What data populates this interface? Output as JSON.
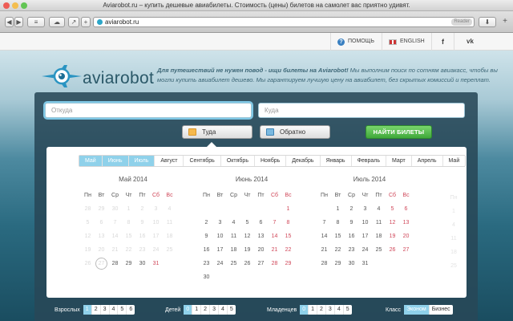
{
  "window": {
    "title": "Aviarobot.ru – купить дешевые авиабилеты. Стоимость (цены) билетов на самолет вас приятно удивят."
  },
  "browser": {
    "url": "aviarobot.ru",
    "reader_label": "Reader"
  },
  "site": {
    "help_label": "ПОМОЩЬ",
    "lang_label": "ENGLISH"
  },
  "hero": {
    "logo_text": "aviarobot",
    "tagline_lead": "Для путешествий не нужен повод - ищи билеты на Aviarobot!",
    "tagline_rest": " Мы выполним поиск по сотням авиакасс, чтобы вы могли купить авиабилет дешево. Мы гарантируем лучшую цену на авиабилет, без скрытых комиссий и переплат."
  },
  "search": {
    "from_placeholder": "Откуда",
    "to_placeholder": "Куда",
    "there_label": "Туда",
    "back_label": "Обратно",
    "find_label": "НАЙТИ БИЛЕТЫ"
  },
  "calendar": {
    "month_tabs": [
      {
        "label": "Май",
        "selected": true
      },
      {
        "label": "Июнь",
        "selected": true
      },
      {
        "label": "Июль",
        "selected": true
      },
      {
        "label": "Август",
        "selected": false
      },
      {
        "label": "Сентябрь",
        "selected": false
      },
      {
        "label": "Октябрь",
        "selected": false
      },
      {
        "label": "Ноябрь",
        "selected": false
      },
      {
        "label": "Декабрь",
        "selected": false
      },
      {
        "label": "Январь",
        "selected": false
      },
      {
        "label": "Февраль",
        "selected": false
      },
      {
        "label": "Март",
        "selected": false
      },
      {
        "label": "Апрель",
        "selected": false
      },
      {
        "label": "Май",
        "selected": false
      }
    ],
    "weekdays": [
      "Пн",
      "Вт",
      "Ср",
      "Чт",
      "Пт",
      "Сб",
      "Вс"
    ],
    "months": [
      {
        "title": "Май 2014",
        "days": [
          "28",
          "29",
          "30",
          "1",
          "2",
          "3",
          "4",
          "5",
          "6",
          "7",
          "8",
          "9",
          "10",
          "11",
          "12",
          "13",
          "14",
          "15",
          "16",
          "17",
          "18",
          "19",
          "20",
          "21",
          "22",
          "23",
          "24",
          "25",
          "26",
          "27",
          "28",
          "29",
          "30",
          "31",
          ""
        ],
        "dim_until": 29,
        "today": 29
      },
      {
        "title": "Июнь 2014",
        "days": [
          "",
          "",
          "",
          "",
          "",
          "",
          "1",
          "2",
          "3",
          "4",
          "5",
          "6",
          "7",
          "8",
          "9",
          "10",
          "11",
          "12",
          "13",
          "14",
          "15",
          "16",
          "17",
          "18",
          "19",
          "20",
          "21",
          "22",
          "23",
          "24",
          "25",
          "26",
          "27",
          "28",
          "29",
          "30",
          "",
          "",
          "",
          "",
          "",
          ""
        ],
        "dim_until": -1,
        "today": -1
      },
      {
        "title": "Июль 2014",
        "days": [
          "",
          "1",
          "2",
          "3",
          "4",
          "5",
          "6",
          "7",
          "8",
          "9",
          "10",
          "11",
          "12",
          "13",
          "14",
          "15",
          "16",
          "17",
          "18",
          "19",
          "20",
          "21",
          "22",
          "23",
          "24",
          "25",
          "26",
          "27",
          "28",
          "29",
          "30",
          "31",
          "",
          "",
          ""
        ],
        "dim_until": -1,
        "today": -1
      }
    ],
    "ghost_column": [
      "Пн",
      "1",
      "4",
      "11",
      "18",
      "25"
    ]
  },
  "passengers": {
    "adults_label": "Взрослых",
    "adults_options": [
      "1",
      "2",
      "3",
      "4",
      "5",
      "6"
    ],
    "children_label": "Детей",
    "children_options": [
      "0",
      "1",
      "2",
      "3",
      "4",
      "5"
    ],
    "infants_label": "Младенцев",
    "infants_options": [
      "0",
      "1",
      "2",
      "3",
      "4",
      "5"
    ],
    "class_label": "Класс",
    "class_options": [
      "Эконом",
      "Бизнес"
    ]
  },
  "colors": {
    "accent": "#8fd1ea",
    "find_button": "#4db445",
    "weekend": "#d0485a"
  }
}
